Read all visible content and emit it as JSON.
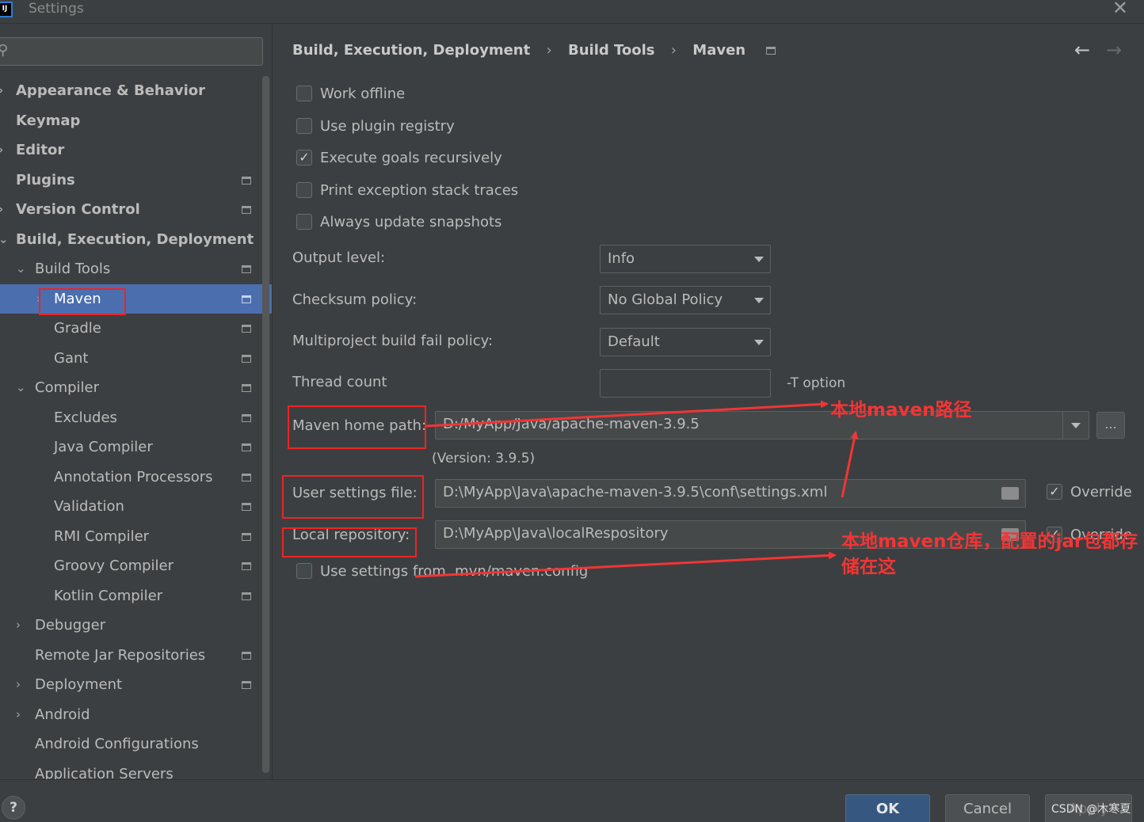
{
  "window": {
    "title": "Settings",
    "app_icon_text": "IJ"
  },
  "sidebar": {
    "items": [
      {
        "label": "Appearance & Behavior",
        "level": 0,
        "chevron": "›",
        "bold": true,
        "project_icon": false,
        "selected": false
      },
      {
        "label": "Keymap",
        "level": 0,
        "chevron": "",
        "bold": true,
        "project_icon": false,
        "selected": false
      },
      {
        "label": "Editor",
        "level": 0,
        "chevron": "›",
        "bold": true,
        "project_icon": false,
        "selected": false
      },
      {
        "label": "Plugins",
        "level": 0,
        "chevron": "",
        "bold": true,
        "project_icon": true,
        "selected": false
      },
      {
        "label": "Version Control",
        "level": 0,
        "chevron": "›",
        "bold": true,
        "project_icon": true,
        "selected": false
      },
      {
        "label": "Build, Execution, Deployment",
        "level": 0,
        "chevron": "⌄",
        "bold": true,
        "project_icon": false,
        "selected": false
      },
      {
        "label": "Build Tools",
        "level": 1,
        "chevron": "⌄",
        "bold": false,
        "project_icon": true,
        "selected": false
      },
      {
        "label": "Maven",
        "level": 2,
        "chevron": "›",
        "bold": false,
        "project_icon": true,
        "selected": true
      },
      {
        "label": "Gradle",
        "level": 2,
        "chevron": "",
        "bold": false,
        "project_icon": true,
        "selected": false
      },
      {
        "label": "Gant",
        "level": 2,
        "chevron": "",
        "bold": false,
        "project_icon": true,
        "selected": false
      },
      {
        "label": "Compiler",
        "level": 1,
        "chevron": "⌄",
        "bold": false,
        "project_icon": true,
        "selected": false
      },
      {
        "label": "Excludes",
        "level": 2,
        "chevron": "",
        "bold": false,
        "project_icon": true,
        "selected": false
      },
      {
        "label": "Java Compiler",
        "level": 2,
        "chevron": "",
        "bold": false,
        "project_icon": true,
        "selected": false
      },
      {
        "label": "Annotation Processors",
        "level": 2,
        "chevron": "",
        "bold": false,
        "project_icon": true,
        "selected": false
      },
      {
        "label": "Validation",
        "level": 2,
        "chevron": "",
        "bold": false,
        "project_icon": true,
        "selected": false
      },
      {
        "label": "RMI Compiler",
        "level": 2,
        "chevron": "",
        "bold": false,
        "project_icon": true,
        "selected": false
      },
      {
        "label": "Groovy Compiler",
        "level": 2,
        "chevron": "",
        "bold": false,
        "project_icon": true,
        "selected": false
      },
      {
        "label": "Kotlin Compiler",
        "level": 2,
        "chevron": "",
        "bold": false,
        "project_icon": true,
        "selected": false
      },
      {
        "label": "Debugger",
        "level": 1,
        "chevron": "›",
        "bold": false,
        "project_icon": false,
        "selected": false
      },
      {
        "label": "Remote Jar Repositories",
        "level": 1,
        "chevron": "",
        "bold": false,
        "project_icon": true,
        "selected": false
      },
      {
        "label": "Deployment",
        "level": 1,
        "chevron": "›",
        "bold": false,
        "project_icon": true,
        "selected": false
      },
      {
        "label": "Android",
        "level": 1,
        "chevron": "›",
        "bold": false,
        "project_icon": false,
        "selected": false
      },
      {
        "label": "Android Configurations",
        "level": 1,
        "chevron": "",
        "bold": false,
        "project_icon": false,
        "selected": false
      },
      {
        "label": "Application Servers",
        "level": 1,
        "chevron": "",
        "bold": false,
        "project_icon": false,
        "selected": false
      }
    ]
  },
  "breadcrumb": {
    "items": [
      "Build, Execution, Deployment",
      "Build Tools",
      "Maven"
    ],
    "separator": "›"
  },
  "options": {
    "work_offline": {
      "label": "Work offline",
      "checked": false
    },
    "use_plugin_registry": {
      "label": "Use plugin registry",
      "checked": false
    },
    "execute_goals_recursively": {
      "label": "Execute goals recursively",
      "checked": true
    },
    "print_exception_stack_traces": {
      "label": "Print exception stack traces",
      "checked": false
    },
    "always_update_snapshots": {
      "label": "Always update snapshots",
      "checked": false
    },
    "use_settings_from_mvn": {
      "label": "Use settings from .mvn/maven.config",
      "checked": false
    }
  },
  "fields": {
    "output_level": {
      "label": "Output level:",
      "value": "Info"
    },
    "checksum_policy": {
      "label": "Checksum policy:",
      "value": "No Global Policy"
    },
    "multiproject_fail_policy": {
      "label": "Multiproject build fail policy:",
      "value": "Default"
    },
    "thread_count": {
      "label": "Thread count",
      "value": "",
      "suffix": "-T option"
    },
    "maven_home_path": {
      "label": "Maven home path:",
      "value": "D:/MyApp/Java/apache-maven-3.9.5",
      "version": "(Version: 3.9.5)",
      "browse_label": "..."
    },
    "user_settings_file": {
      "label": "User settings file:",
      "value": "D:\\MyApp\\Java\\apache-maven-3.9.5\\conf\\settings.xml",
      "override_label": "Override",
      "override_checked": true
    },
    "local_repository": {
      "label": "Local repository:",
      "value": "D:\\MyApp\\Java\\localRespository",
      "override_label": "Override",
      "override_checked": true
    }
  },
  "annotations": {
    "maven_path_note": "本地maven路径",
    "repo_note_line1": "本地maven仓库，配置的jar包都存",
    "repo_note_line2": "储在这",
    "color": "#f23535"
  },
  "footer": {
    "help_label": "?",
    "ok_label": "OK",
    "cancel_label": "Cancel",
    "apply_label": "Apply",
    "watermark": "CSDN @木寒夏"
  },
  "colors": {
    "background": "#3c3f41",
    "selection": "#4b6eaf",
    "ok_button": "#365880"
  }
}
